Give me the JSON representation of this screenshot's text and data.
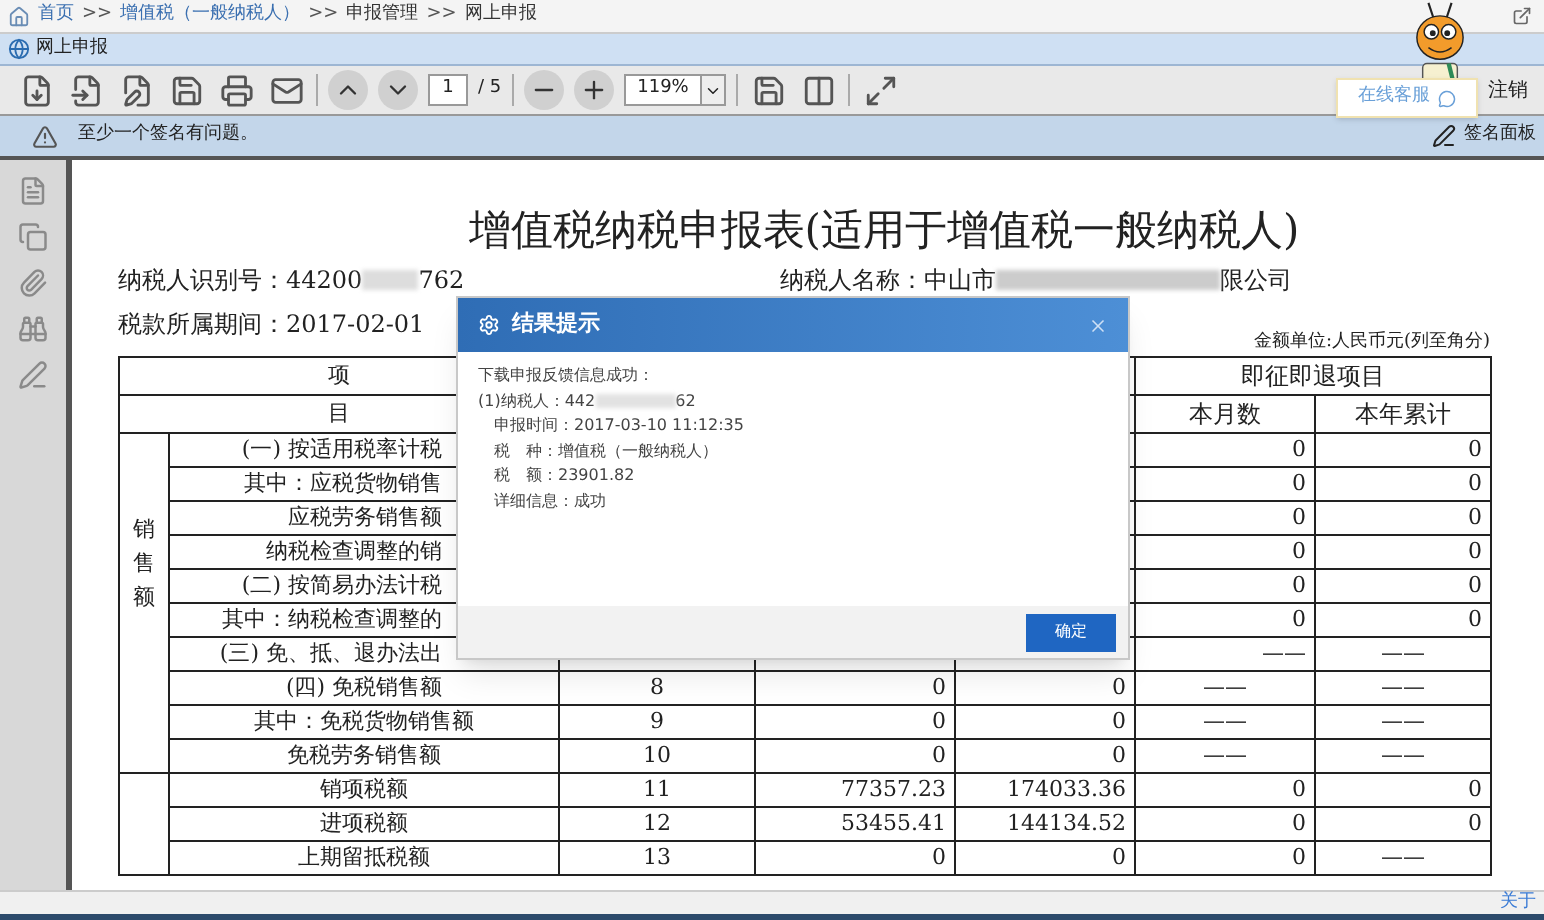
{
  "breadcrumb": [
    {
      "kind": "link",
      "text": "首页"
    },
    {
      "kind": "separator",
      "text": ">>"
    },
    {
      "kind": "link",
      "text": "增值税（一般纳税人）"
    },
    {
      "kind": "separator",
      "text": ">>"
    },
    {
      "kind": "current",
      "text": "申报管理"
    },
    {
      "kind": "separator",
      "text": ">>"
    },
    {
      "kind": "current",
      "text": "网上申报"
    }
  ],
  "tab": {
    "label": "网上申报"
  },
  "toolbar": {
    "page": "1",
    "page_total": "/ 5",
    "zoom": "119%",
    "support_button": "在线客服",
    "logout": "注销"
  },
  "signature_bar": {
    "message": "至少一个签名有问题。",
    "panel_button": "签名面板"
  },
  "document": {
    "title": "增值税纳税申报表(适用于增值税一般纳税人)",
    "taxpayer_id_label": "纳税人识别号：",
    "taxpayer_id_start": "44200",
    "taxpayer_id_end": "762",
    "taxpayer_name_label": "纳税人名称：",
    "taxpayer_name_start": "中山市",
    "taxpayer_name_end": "限公司",
    "period": "税款所属期间：2017-02-01",
    "unit": "金额单位:人民币元(列至角分)",
    "header": {
      "item_top": "项",
      "item_bottom": "目",
      "refund_group": "即征即退项目",
      "refund_month": "本月数",
      "refund_year": "本年累计"
    },
    "groups": [
      {
        "label": "销售额",
        "rows": [
          {
            "kind": "covered",
            "cells": [
              "(一) 按适用税率计税",
              "0",
              "0"
            ]
          },
          {
            "kind": "covered",
            "cells": [
              "其中：应税货物销售",
              "0",
              "0"
            ]
          },
          {
            "kind": "covered",
            "cells": [
              "应税劳务销售额",
              "0",
              "0"
            ]
          },
          {
            "kind": "covered",
            "cells": [
              "纳税检查调整的销",
              "0",
              "0"
            ]
          },
          {
            "kind": "covered",
            "cells": [
              "(二) 按简易办法计税",
              "0",
              "0"
            ]
          },
          {
            "kind": "covered",
            "cells": [
              "其中：纳税检查调整的",
              "0",
              "0"
            ]
          },
          {
            "kind": "covered",
            "cells": [
              "(三) 免、抵、退办法出",
              "——",
              "——"
            ]
          },
          {
            "kind": "full",
            "cells": [
              "(四) 免税销售额",
              "8",
              "0",
              "0",
              "——",
              "——"
            ]
          },
          {
            "kind": "full",
            "cells": [
              "其中：免税货物销售额",
              "9",
              "0",
              "0",
              "——",
              "——"
            ]
          },
          {
            "kind": "full",
            "cells": [
              "免税劳务销售额",
              "10",
              "0",
              "0",
              "——",
              "——"
            ]
          }
        ]
      },
      {
        "rows": [
          {
            "kind": "full",
            "cells": [
              "销项税额",
              "11",
              "77357.23",
              "174033.36",
              "0",
              "0"
            ]
          },
          {
            "kind": "full",
            "cells": [
              "进项税额",
              "12",
              "53455.41",
              "144134.52",
              "0",
              "0"
            ]
          },
          {
            "kind": "full",
            "cells": [
              "上期留抵税额",
              "13",
              "0",
              "0",
              "0",
              "——"
            ]
          }
        ]
      }
    ]
  },
  "dialog": {
    "title": "结果提示",
    "lines": [
      {
        "kind": "heading",
        "text": "下载申报反馈信息成功："
      },
      {
        "kind": "masked",
        "start": "(1)纳税人：442",
        "end": "62"
      },
      {
        "kind": "detail",
        "text": "申报时间：2017-03-10 11:12:35"
      },
      {
        "kind": "detail",
        "text": "税　种：增值税（一般纳税人）"
      },
      {
        "kind": "detail",
        "text": "税　额：23901.82"
      },
      {
        "kind": "detail",
        "text": "详细信息：成功"
      }
    ],
    "ok_button": "确定"
  },
  "status_bar": {
    "about": "关于"
  }
}
